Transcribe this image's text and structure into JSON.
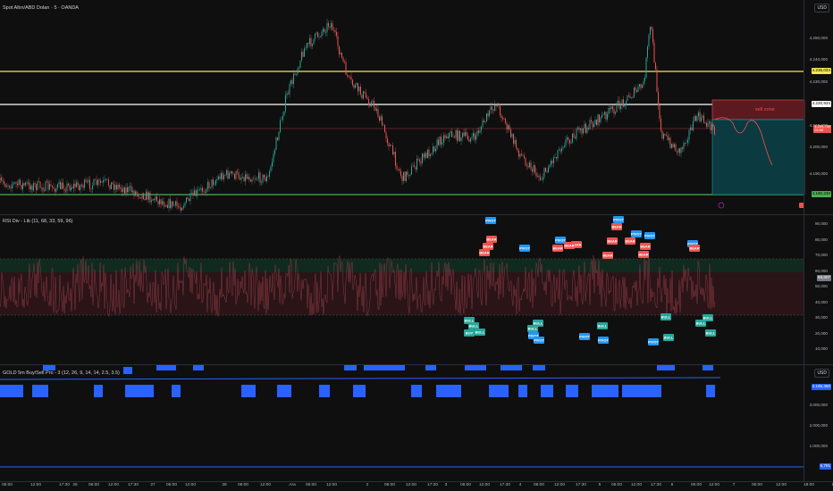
{
  "main": {
    "title": "Spot Altın/ABD Doları · 5 · OANDA",
    "currency": "USD",
    "price_ticks": [
      "4.250,000",
      "4.240,000",
      "4.230,000",
      "4.210,000",
      "4.200,000",
      "4.190,000"
    ],
    "level_yellow": "4.235,034",
    "level_white": "4.220,934",
    "level_green": "4.180,230",
    "last_price": "4.209,730",
    "countdown": "03:55",
    "sell_zone": "sell zone"
  },
  "rsi": {
    "title": "RSI Div - Lib (11, 68, 33, 59, 96)",
    "ticks": [
      "90,000",
      "80,000",
      "70,000",
      "60,000",
      "50,000",
      "40,000",
      "30,000",
      "20,000",
      "10,000"
    ],
    "value": "56,607",
    "labels": {
      "bear": "BEAR",
      "bull": "BULL",
      "pivot": "PIVOT",
      "buy": "BUY"
    }
  },
  "gold": {
    "title": "GOLD 5m Buy/Sell Pro - 3 (12, 26, 9, 14, 14, 2.5, 3.5)",
    "currency": "USD",
    "ticks": [
      "3.000,000",
      "2.000,000",
      "1.000,000"
    ],
    "value_top": "4.195,350",
    "value_bottom": "6,791"
  },
  "time_axis": [
    "06:00",
    "12:00",
    "17:30",
    "26",
    "06:00",
    "12:00",
    "17:30",
    "27",
    "06:00",
    "12:00",
    "28",
    "06:00",
    "12:00",
    "Ara",
    "06:00",
    "12:00",
    "2",
    "06:00",
    "12:00",
    "17:30",
    "3",
    "06:00",
    "12:00",
    "17:30",
    "4",
    "06:00",
    "12:00",
    "17:30",
    "5",
    "06:00",
    "12:00",
    "17:30",
    "6",
    "06:00",
    "12:00",
    "7",
    "06:00",
    "12:00",
    "18:00",
    "9",
    "06:00",
    "12:00"
  ],
  "colors": {
    "bull": "#26a69a",
    "bear": "#ef5350",
    "pivot": "#2196f3",
    "yellow": "#f5e84c",
    "green": "#4caf50",
    "blue": "#2962ff"
  }
}
